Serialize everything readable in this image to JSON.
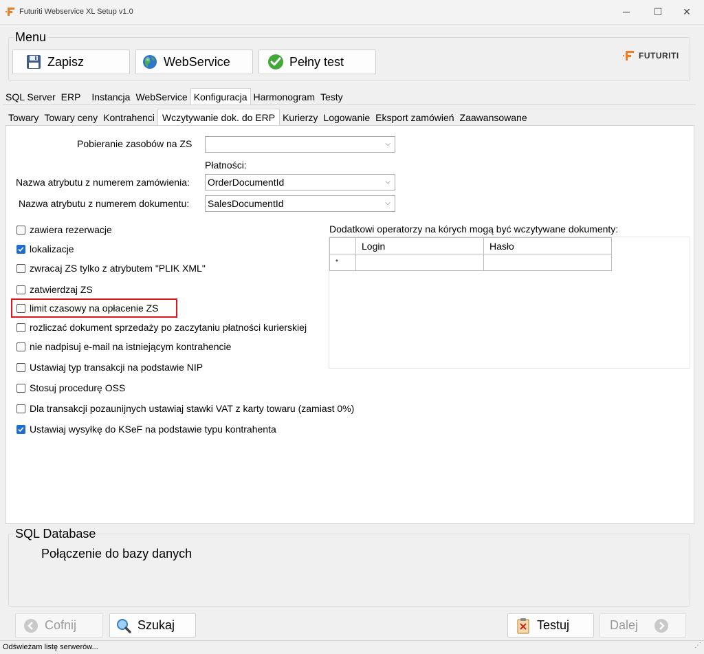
{
  "window": {
    "title": "Futuriti Webservice XL Setup v1.0"
  },
  "menu": {
    "legend": "Menu",
    "buttons": {
      "save": "Zapisz",
      "webservice": "WebService",
      "fulltest": "Pełny test"
    },
    "logo_text": "FUTURITI"
  },
  "main_tabs": [
    "SQL Server",
    "ERP",
    "Instancja",
    "WebService",
    "Konfiguracja",
    "Harmonogram",
    "Testy"
  ],
  "main_tab_active": "Konfiguracja",
  "sub_tabs": [
    "Towary",
    "Towary ceny",
    "Kontrahenci",
    "Wczytywanie dok. do ERP",
    "Kurierzy",
    "Logowanie",
    "Eksport zamówień",
    "Zaawansowane"
  ],
  "sub_tab_active": "Wczytywanie dok. do ERP",
  "form": {
    "resources_label": "Pobieranie zasobów na ZS",
    "resources_value": "",
    "payments_caption": "Płatności:",
    "order_attr_label": "Nazwa atrybutu z numerem zamówienia:",
    "order_attr_value": "OrderDocumentId",
    "doc_attr_label": "Nazwa atrybutu z numerem dokumentu:",
    "doc_attr_value": "SalesDocumentId"
  },
  "checkboxes": [
    {
      "label": "zawiera rezerwacje",
      "checked": false
    },
    {
      "label": "lokalizacje",
      "checked": true
    },
    {
      "label": "zwracaj ZS tylko z atrybutem \"PLIK XML\"",
      "checked": false
    },
    {
      "label": "zatwierdzaj ZS",
      "checked": false
    },
    {
      "label": "limit czasowy na opłacenie ZS",
      "checked": false
    },
    {
      "label": "rozliczać dokument sprzedaży po zaczytaniu płatności kurierskiej",
      "checked": false
    },
    {
      "label": "nie nadpisuj e-mail na istniejącym kontrahencie",
      "checked": false
    },
    {
      "label": "Ustawiaj typ transakcji na podstawie NIP",
      "checked": false
    },
    {
      "label": "Stosuj procedurę OSS",
      "checked": false
    },
    {
      "label": "Dla transakcji pozaunijnych ustawiaj stawki VAT z karty towaru (zamiast 0%)",
      "checked": false
    },
    {
      "label": "Ustawiaj wysyłkę do KSeF na podstawie typu kontrahenta",
      "checked": true
    }
  ],
  "operators": {
    "caption": "Dodatkowi operatorzy na kórych mogą być wczytywane dokumenty:",
    "columns": [
      "Login",
      "Hasło"
    ],
    "new_row_marker": "*"
  },
  "sql_database": {
    "legend": "SQL Database",
    "text": "Połączenie do bazy danych"
  },
  "nav": {
    "back": "Cofnij",
    "search": "Szukaj",
    "test": "Testuj",
    "next": "Dalej"
  },
  "status": {
    "text": "Odświeżam listę serwerów..."
  }
}
